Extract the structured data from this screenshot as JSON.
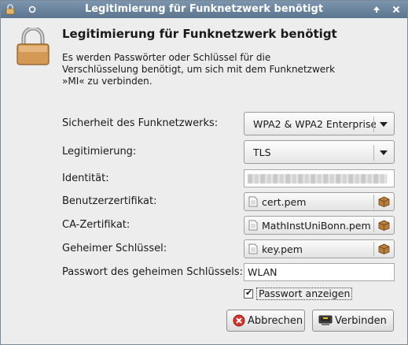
{
  "window": {
    "title": "Legitimierung für Funknetzwerk benötigt"
  },
  "dialog": {
    "heading": "Legitimierung für Funknetzwerk benötigt",
    "description_line1": "Es werden Passwörter oder Schlüssel für die",
    "description_line2": "Verschlüsselung benötigt, um sich mit dem Funknetzwerk",
    "description_line3": "»MI« zu verbinden."
  },
  "form": {
    "security_label": "Sicherheit des Funknetzwerks:",
    "security_value": "WPA2 & WPA2 Enterprise",
    "auth_label": "Legitimierung:",
    "auth_value": "TLS",
    "identity_label": "Identität:",
    "user_cert_label": "Benutzerzertifikat:",
    "user_cert_value": "cert.pem",
    "ca_cert_label": "CA-Zertifikat:",
    "ca_cert_value": "MathInstUniBonn.pem",
    "private_key_label": "Geheimer Schlüssel:",
    "private_key_value": "key.pem",
    "key_password_label": "Passwort des geheimen Schlüssels:",
    "key_password_value": "WLAN",
    "show_password_label": "Passwort anzeigen",
    "show_password_checked": true
  },
  "buttons": {
    "cancel_label": "Abbrechen",
    "connect_label": "Verbinden"
  },
  "icons": {
    "lock": "padlock-icon",
    "window_menu": "window-menu-icon",
    "pin": "pin-icon",
    "maximize": "maximize-icon",
    "close": "close-icon",
    "file": "file-icon",
    "folder": "box-folder-icon",
    "cancel": "cancel-icon",
    "connect": "network-connect-icon"
  }
}
